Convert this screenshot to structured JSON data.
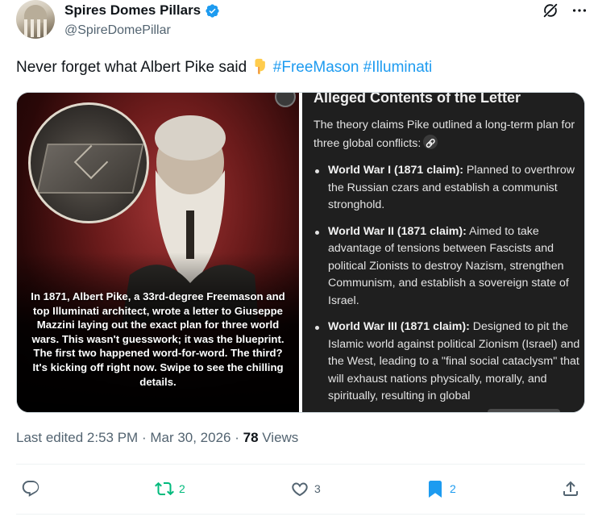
{
  "author": {
    "display_name": "Spires Domes Pillars",
    "handle": "@SpireDomePillar",
    "verified": true
  },
  "header_icons": [
    "grok-icon",
    "more-icon"
  ],
  "post": {
    "text": "Never forget what Albert Pike said ",
    "emoji": "backhand-index-pointing-down-emoji",
    "hashtags": [
      "#FreeMason",
      "#Illuminati"
    ]
  },
  "media": {
    "left_caption": "In 1871, Albert Pike, a 33rd-degree Freemason and top Illuminati architect, wrote a letter to Giuseppe Mazzini laying out the exact plan for three world wars. This wasn't guesswork; it was the blueprint. The first two happened word-for-word. The third? It's kicking off right now. Swipe to see the chilling details.",
    "right_title": "Alleged Contents of the Letter",
    "right_intro": "The theory claims Pike outlined a long-term plan for three global conflicts:",
    "right_items": [
      {
        "heading": "World War I (1871 claim):",
        "text": " Planned to overthrow the Russian czars and establish a communist stronghold."
      },
      {
        "heading": "World War II (1871 claim):",
        "text": " Aimed to take advantage of tensions between Fascists and political Zionists to destroy Nazism, strengthen Communism, and establish a sovereign state of Israel."
      },
      {
        "heading": "World War III (1871 claim):",
        "text": " Designed to pit the Islamic world against political Zionism (Israel) and the West, leading to a \"final social cataclysm\" that will exhaust nations physically, morally, and spiritually, resulting in global"
      }
    ]
  },
  "meta": {
    "edited": "Last edited 2:53 PM",
    "dot1": " · ",
    "date": "Mar 30, 2026",
    "dot2": " · ",
    "views_count": "78",
    "views_label": " Views"
  },
  "actions": {
    "reply": {
      "icon": "reply-icon",
      "count": ""
    },
    "retweet": {
      "icon": "retweet-icon",
      "count": "2"
    },
    "like": {
      "icon": "heart-icon",
      "count": "3"
    },
    "bookmark": {
      "icon": "bookmark-icon",
      "count": "2"
    },
    "share": {
      "icon": "share-icon",
      "count": ""
    }
  },
  "colors": {
    "accent": "#1d9bf0",
    "retweet": "#00ba7c",
    "muted": "#536471",
    "text": "#0f1419"
  }
}
